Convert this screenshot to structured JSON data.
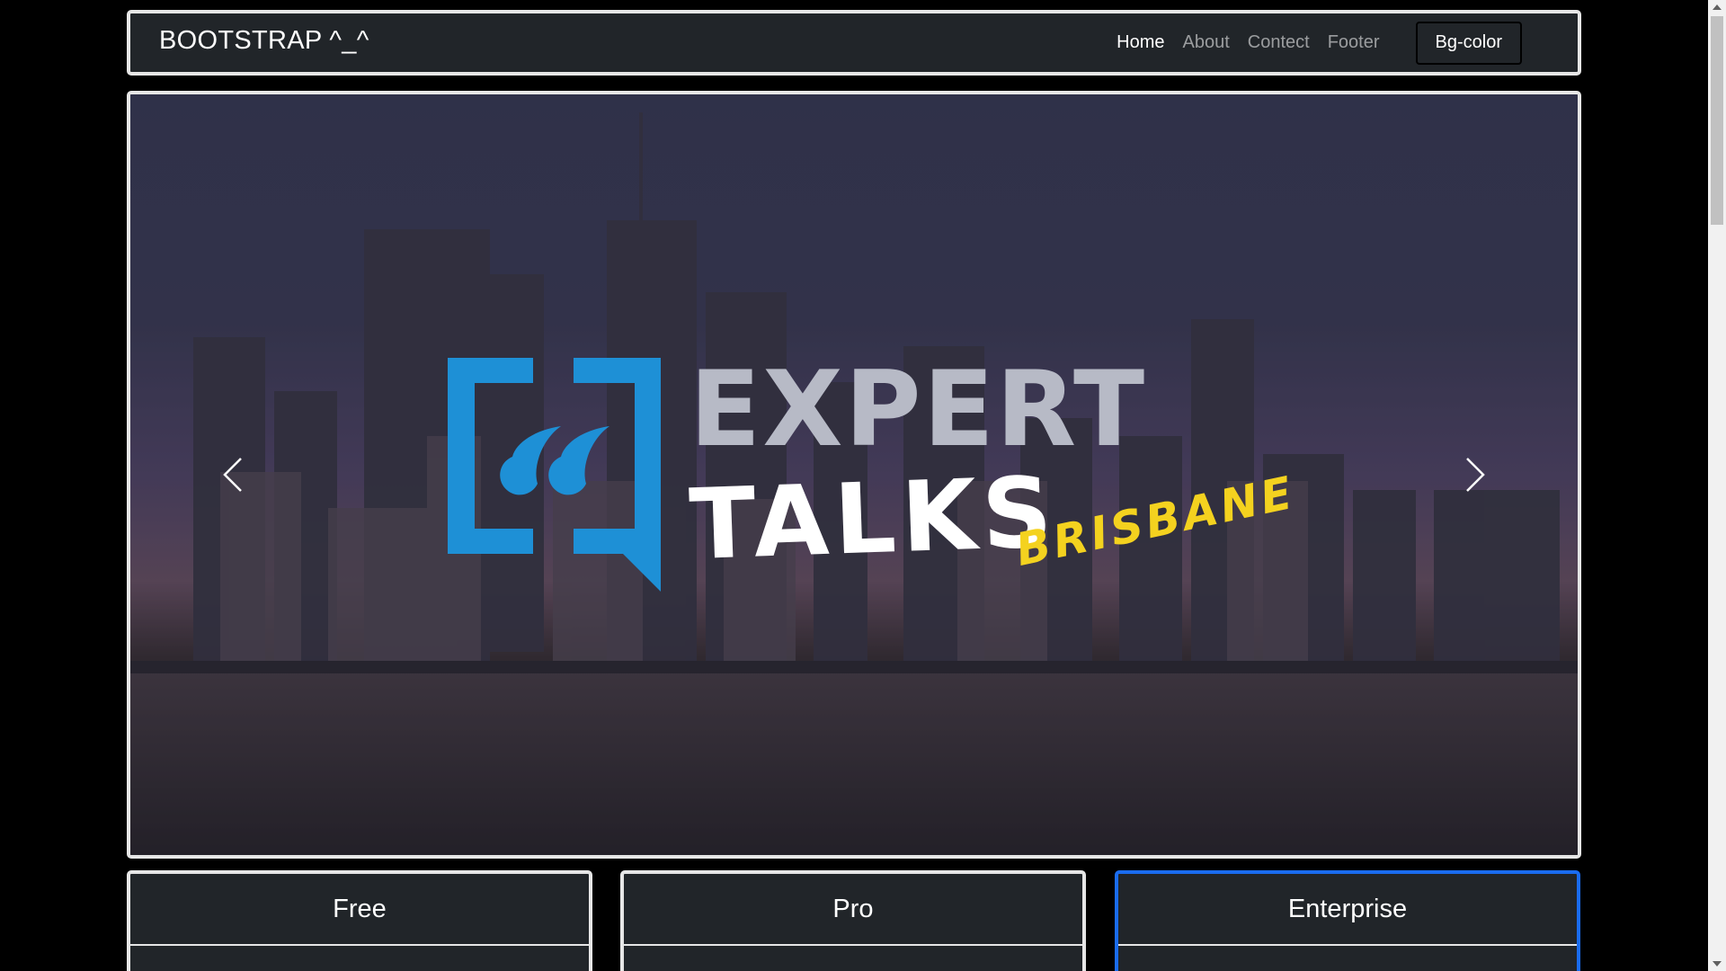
{
  "navbar": {
    "brand": "BOOTSTRAP ^_^",
    "links": [
      {
        "label": "Home",
        "active": true
      },
      {
        "label": "About",
        "active": false
      },
      {
        "label": "Contect",
        "active": false
      },
      {
        "label": "Footer",
        "active": false
      }
    ],
    "bg_button": "Bg-color"
  },
  "carousel": {
    "slide_logo": {
      "line1": "EXPERT",
      "line2": "TALKS",
      "line3": "BRISBANE"
    },
    "prev_icon": "chevron-left-icon",
    "next_icon": "chevron-right-icon"
  },
  "pricing": {
    "cards": [
      {
        "title": "Free",
        "featured": false
      },
      {
        "title": "Pro",
        "featured": false
      },
      {
        "title": "Enterprise",
        "featured": true
      }
    ]
  },
  "colors": {
    "navbar_bg": "#212529",
    "border": "#e6e6e6",
    "featured_border": "#1a6cf0",
    "logo_blue": "#1e90d6",
    "logo_grey": "#b7bac6",
    "logo_yellow": "#f4d21f"
  }
}
